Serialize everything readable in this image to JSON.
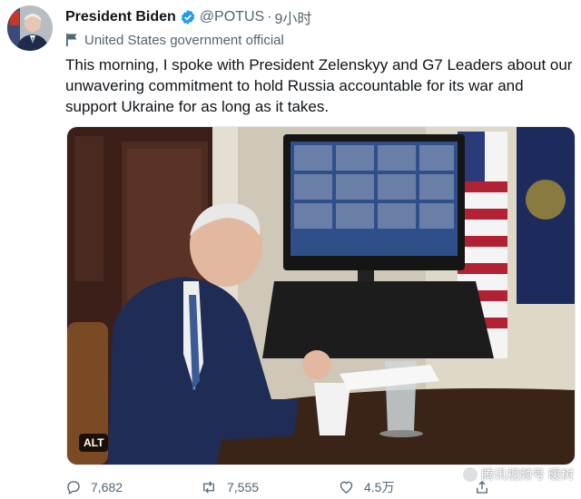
{
  "tweet": {
    "author_name": "President Biden",
    "handle": "@POTUS",
    "separator": "·",
    "time": "9小时",
    "account_label": "United States government official",
    "text": "This morning, I spoke with President Zelenskyy and G7 Leaders about our unwavering commitment to hold Russia accountable for its war and support Ukraine for as long as it takes.",
    "alt_badge": "ALT",
    "replies": "7,682",
    "retweets": "7,555",
    "likes": "4.5万"
  },
  "watermark": "腾讯视频号 暖树",
  "colors": {
    "verified": "#1d9bf0",
    "muted": "#536471",
    "text": "#0f1419"
  },
  "icons": [
    "verified-badge-icon",
    "government-flag-icon",
    "reply-icon",
    "retweet-icon",
    "like-icon",
    "share-icon"
  ]
}
